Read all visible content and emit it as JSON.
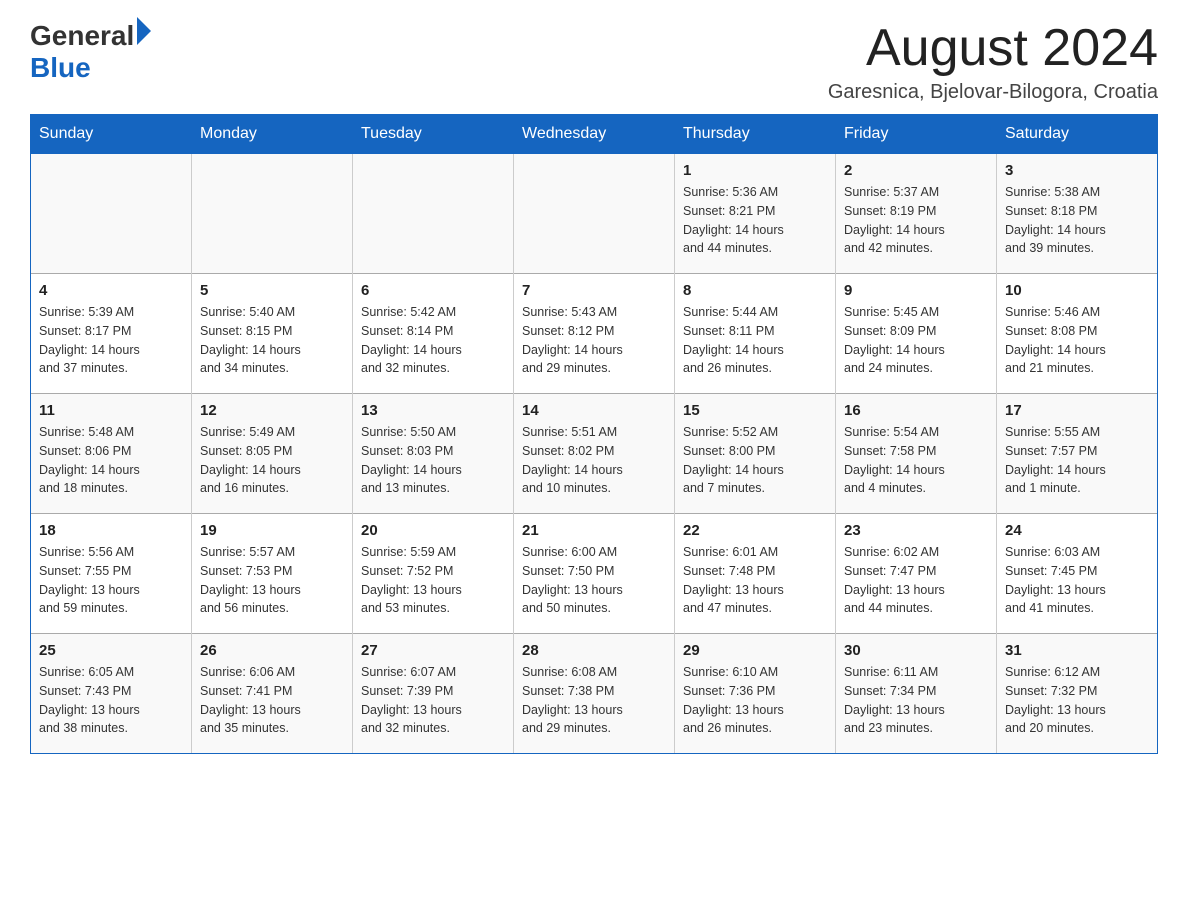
{
  "header": {
    "logo": {
      "general": "General",
      "blue": "Blue"
    },
    "title": "August 2024",
    "location": "Garesnica, Bjelovar-Bilogora, Croatia"
  },
  "calendar": {
    "days_of_week": [
      "Sunday",
      "Monday",
      "Tuesday",
      "Wednesday",
      "Thursday",
      "Friday",
      "Saturday"
    ],
    "weeks": [
      {
        "days": [
          {
            "number": "",
            "info": ""
          },
          {
            "number": "",
            "info": ""
          },
          {
            "number": "",
            "info": ""
          },
          {
            "number": "",
            "info": ""
          },
          {
            "number": "1",
            "info": "Sunrise: 5:36 AM\nSunset: 8:21 PM\nDaylight: 14 hours\nand 44 minutes."
          },
          {
            "number": "2",
            "info": "Sunrise: 5:37 AM\nSunset: 8:19 PM\nDaylight: 14 hours\nand 42 minutes."
          },
          {
            "number": "3",
            "info": "Sunrise: 5:38 AM\nSunset: 8:18 PM\nDaylight: 14 hours\nand 39 minutes."
          }
        ]
      },
      {
        "days": [
          {
            "number": "4",
            "info": "Sunrise: 5:39 AM\nSunset: 8:17 PM\nDaylight: 14 hours\nand 37 minutes."
          },
          {
            "number": "5",
            "info": "Sunrise: 5:40 AM\nSunset: 8:15 PM\nDaylight: 14 hours\nand 34 minutes."
          },
          {
            "number": "6",
            "info": "Sunrise: 5:42 AM\nSunset: 8:14 PM\nDaylight: 14 hours\nand 32 minutes."
          },
          {
            "number": "7",
            "info": "Sunrise: 5:43 AM\nSunset: 8:12 PM\nDaylight: 14 hours\nand 29 minutes."
          },
          {
            "number": "8",
            "info": "Sunrise: 5:44 AM\nSunset: 8:11 PM\nDaylight: 14 hours\nand 26 minutes."
          },
          {
            "number": "9",
            "info": "Sunrise: 5:45 AM\nSunset: 8:09 PM\nDaylight: 14 hours\nand 24 minutes."
          },
          {
            "number": "10",
            "info": "Sunrise: 5:46 AM\nSunset: 8:08 PM\nDaylight: 14 hours\nand 21 minutes."
          }
        ]
      },
      {
        "days": [
          {
            "number": "11",
            "info": "Sunrise: 5:48 AM\nSunset: 8:06 PM\nDaylight: 14 hours\nand 18 minutes."
          },
          {
            "number": "12",
            "info": "Sunrise: 5:49 AM\nSunset: 8:05 PM\nDaylight: 14 hours\nand 16 minutes."
          },
          {
            "number": "13",
            "info": "Sunrise: 5:50 AM\nSunset: 8:03 PM\nDaylight: 14 hours\nand 13 minutes."
          },
          {
            "number": "14",
            "info": "Sunrise: 5:51 AM\nSunset: 8:02 PM\nDaylight: 14 hours\nand 10 minutes."
          },
          {
            "number": "15",
            "info": "Sunrise: 5:52 AM\nSunset: 8:00 PM\nDaylight: 14 hours\nand 7 minutes."
          },
          {
            "number": "16",
            "info": "Sunrise: 5:54 AM\nSunset: 7:58 PM\nDaylight: 14 hours\nand 4 minutes."
          },
          {
            "number": "17",
            "info": "Sunrise: 5:55 AM\nSunset: 7:57 PM\nDaylight: 14 hours\nand 1 minute."
          }
        ]
      },
      {
        "days": [
          {
            "number": "18",
            "info": "Sunrise: 5:56 AM\nSunset: 7:55 PM\nDaylight: 13 hours\nand 59 minutes."
          },
          {
            "number": "19",
            "info": "Sunrise: 5:57 AM\nSunset: 7:53 PM\nDaylight: 13 hours\nand 56 minutes."
          },
          {
            "number": "20",
            "info": "Sunrise: 5:59 AM\nSunset: 7:52 PM\nDaylight: 13 hours\nand 53 minutes."
          },
          {
            "number": "21",
            "info": "Sunrise: 6:00 AM\nSunset: 7:50 PM\nDaylight: 13 hours\nand 50 minutes."
          },
          {
            "number": "22",
            "info": "Sunrise: 6:01 AM\nSunset: 7:48 PM\nDaylight: 13 hours\nand 47 minutes."
          },
          {
            "number": "23",
            "info": "Sunrise: 6:02 AM\nSunset: 7:47 PM\nDaylight: 13 hours\nand 44 minutes."
          },
          {
            "number": "24",
            "info": "Sunrise: 6:03 AM\nSunset: 7:45 PM\nDaylight: 13 hours\nand 41 minutes."
          }
        ]
      },
      {
        "days": [
          {
            "number": "25",
            "info": "Sunrise: 6:05 AM\nSunset: 7:43 PM\nDaylight: 13 hours\nand 38 minutes."
          },
          {
            "number": "26",
            "info": "Sunrise: 6:06 AM\nSunset: 7:41 PM\nDaylight: 13 hours\nand 35 minutes."
          },
          {
            "number": "27",
            "info": "Sunrise: 6:07 AM\nSunset: 7:39 PM\nDaylight: 13 hours\nand 32 minutes."
          },
          {
            "number": "28",
            "info": "Sunrise: 6:08 AM\nSunset: 7:38 PM\nDaylight: 13 hours\nand 29 minutes."
          },
          {
            "number": "29",
            "info": "Sunrise: 6:10 AM\nSunset: 7:36 PM\nDaylight: 13 hours\nand 26 minutes."
          },
          {
            "number": "30",
            "info": "Sunrise: 6:11 AM\nSunset: 7:34 PM\nDaylight: 13 hours\nand 23 minutes."
          },
          {
            "number": "31",
            "info": "Sunrise: 6:12 AM\nSunset: 7:32 PM\nDaylight: 13 hours\nand 20 minutes."
          }
        ]
      }
    ]
  }
}
